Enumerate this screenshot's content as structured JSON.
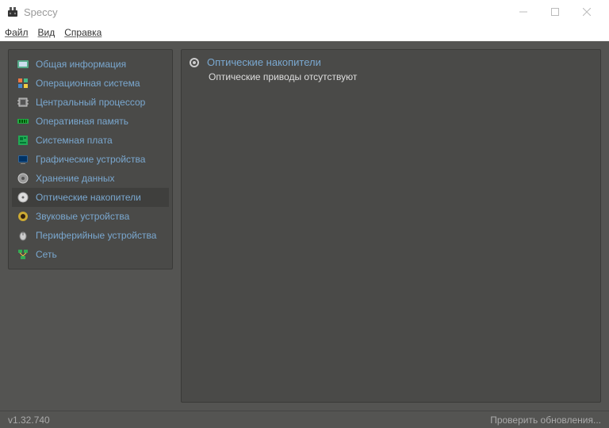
{
  "window": {
    "title": "Speccy"
  },
  "menu": {
    "file": "Файл",
    "view": "Вид",
    "help": "Справка"
  },
  "sidebar": {
    "items": [
      {
        "label": "Общая информация",
        "icon": "summary"
      },
      {
        "label": "Операционная система",
        "icon": "os"
      },
      {
        "label": "Центральный процессор",
        "icon": "cpu"
      },
      {
        "label": "Оперативная память",
        "icon": "ram"
      },
      {
        "label": "Системная плата",
        "icon": "motherboard"
      },
      {
        "label": "Графические устройства",
        "icon": "graphics"
      },
      {
        "label": "Хранение данных",
        "icon": "storage"
      },
      {
        "label": "Оптические накопители",
        "icon": "optical"
      },
      {
        "label": "Звуковые устройства",
        "icon": "audio"
      },
      {
        "label": "Периферийные устройства",
        "icon": "peripherals"
      },
      {
        "label": "Сеть",
        "icon": "network"
      }
    ]
  },
  "main": {
    "section_title": "Оптические накопители",
    "section_body": "Оптические приводы отсутствуют"
  },
  "status": {
    "version": "v1.32.740",
    "check_updates": "Проверить обновления..."
  }
}
